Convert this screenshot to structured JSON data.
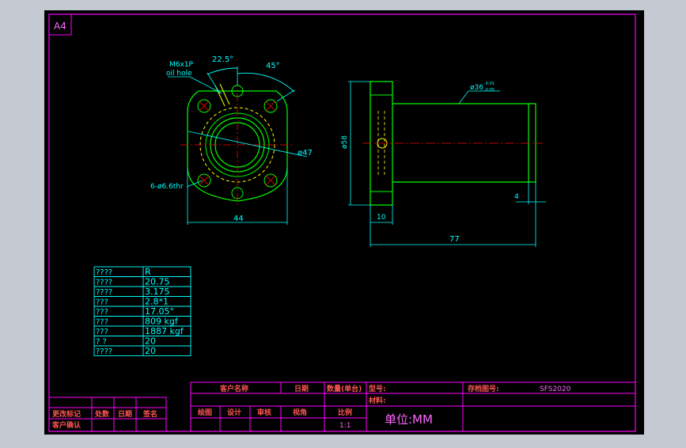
{
  "sheet": {
    "size_label": "A4"
  },
  "front_view": {
    "angle_1": "22.5°",
    "angle_2": "45°",
    "oil_hole_label_1": "M6x1P",
    "oil_hole_label_2": "oil hole",
    "bolt_holes": "6-ø6.6thr",
    "pcd": "ø47",
    "width": "44"
  },
  "side_view": {
    "flange_dia": "ø58",
    "body_dia": "ø36",
    "body_tol_upper": "-0.01",
    "body_tol_lower": "-0.05",
    "flange_thickness": "10",
    "total_length": "77",
    "end_width": "4"
  },
  "spec_table": [
    {
      "key": "????",
      "value": "R"
    },
    {
      "key": "????",
      "value": "20.75"
    },
    {
      "key": "????",
      "value": "3.175"
    },
    {
      "key": "???",
      "value": "2.8*1"
    },
    {
      "key": "???",
      "value": "17.05°"
    },
    {
      "key": "???",
      "value": "809 kgf"
    },
    {
      "key": "???",
      "value": "1887 kgf"
    },
    {
      "key": "?  ?",
      "value": "20"
    },
    {
      "key": "????",
      "value": "20"
    }
  ],
  "title_block": {
    "customer_name": "客户名称",
    "date": "日期",
    "quantity": "数量(单台)",
    "model": "型号:",
    "drawing_no_label": "存档图号:",
    "drawing_no": "SFS2020",
    "material": "材料:",
    "drawn": "绘图",
    "design": "设计",
    "review": "审核",
    "projection": "视角",
    "scale_label": "比例",
    "scale": "1:1",
    "unit": "单位:MM"
  },
  "revision_block": {
    "change_mark": "更改标记",
    "location": "处数",
    "date": "日期",
    "signature": "签名",
    "customer_confirm": "客户确认"
  },
  "colors": {
    "background": "#000000",
    "frame": "#ff00ff",
    "outline": "#00ff00",
    "dimension": "#00ffff",
    "hidden": "#ffff00",
    "center": "#ff0000",
    "text_accent": "#ff5555",
    "unit_text": "#ff66ff"
  }
}
